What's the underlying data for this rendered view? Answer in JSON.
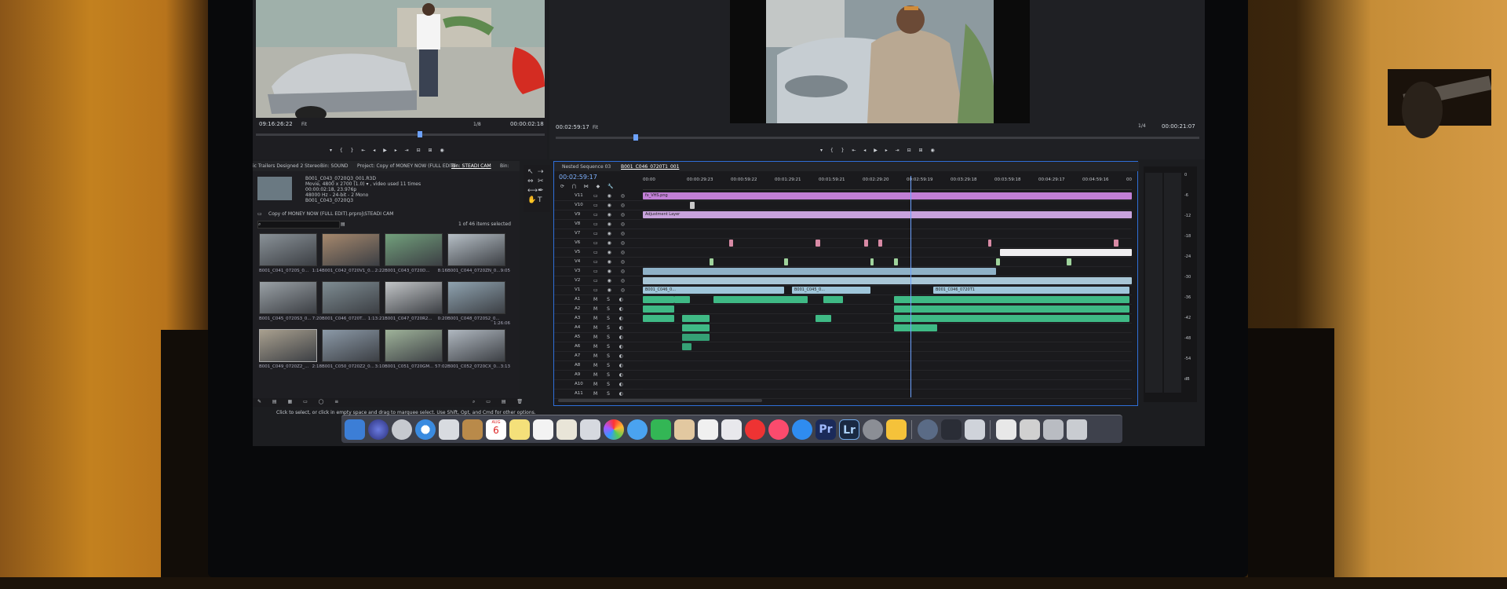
{
  "source_monitor": {
    "timecode_left": "09:16:26:22",
    "fit": "Fit",
    "fraction": "1/8",
    "timecode_right": "00:00:02:18"
  },
  "program_monitor": {
    "timecode_left": "00:02:59:17",
    "fit": "Fit",
    "fraction": "1/4",
    "timecode_right": "00:00:21:07"
  },
  "project_panel": {
    "tabs": [
      "ic Trailers Designed 2 Stereo",
      "Bin: SOUND",
      "Project: Copy of MONEY NOW (FULL EDIT)",
      "Bin: STEADI CAM",
      "Bin:"
    ],
    "clip_info": [
      "B001_C043_0720Q3_001.R3D",
      "Movie, 4800 x 2700 (1.0) ▾ , video used 11 times",
      "00:00:02:18, 23.976p",
      "48000 Hz - 24-bit - 2 Mono",
      "B001_C043_0720Q3"
    ],
    "path": "Copy of MONEY NOW (FULL EDIT).prproj\\STEADI CAM",
    "item_count": "1 of 46 items selected",
    "thumbnails": [
      {
        "name": "B001_C041_0720S_0...",
        "dur": "1:14"
      },
      {
        "name": "B001_C042_0720V1_0...",
        "dur": "2:22"
      },
      {
        "name": "B001_C043_0720D...",
        "dur": "8:16"
      },
      {
        "name": "B001_C044_0720ZN_0...",
        "dur": "9:05"
      },
      {
        "name": "B001_C045_0720S3_0...",
        "dur": "7:20"
      },
      {
        "name": "B001_C046_0720T...",
        "dur": "1:13:21"
      },
      {
        "name": "B001_C047_0720R2...",
        "dur": "0:20"
      },
      {
        "name": "B001_C048_0720S2_0...",
        "dur": "1:26:06"
      },
      {
        "name": "B001_C049_0720Z2_...",
        "dur": "2:18"
      },
      {
        "name": "B001_C050_0720Z2_0...",
        "dur": "3:10"
      },
      {
        "name": "B001_C051_0720GM...",
        "dur": "57:02"
      },
      {
        "name": "B001_C052_0720CX_0...",
        "dur": "3:13"
      }
    ]
  },
  "timeline": {
    "tabs": [
      "Nested Sequence 03",
      "B001_C046_0720T1_001"
    ],
    "timecode": "00:02:59:17",
    "ruler": [
      "00:00",
      "00:00:29:23",
      "00:00:59:22",
      "00:01:29:21",
      "00:01:59:21",
      "00:02:29:20",
      "00:02:59:19",
      "00:03:29:18",
      "00:03:59:18",
      "00:04:29:17",
      "00:04:59:16",
      "00"
    ],
    "video_tracks": [
      "V11",
      "V10",
      "V9",
      "V8",
      "V7",
      "V6",
      "V5",
      "V4",
      "V3",
      "V2",
      "V1"
    ],
    "audio_tracks": [
      "A1",
      "A2",
      "A3",
      "A4",
      "A5",
      "A6",
      "A7",
      "A8",
      "A9",
      "A10",
      "A11"
    ],
    "labels": {
      "fx": "fx_VHS.png",
      "adjustment": "Adjustment Layer",
      "clip_a": "B001_C046_0...",
      "clip_b": "B001_C045_0...",
      "clip_c": "B001_C046_0720T1"
    }
  },
  "meter_scale": [
    "0",
    "-6",
    "-12",
    "-18",
    "-24",
    "-30",
    "-36",
    "-42",
    "-48",
    "-54",
    "dB"
  ],
  "status_bar": "Click to select, or click in empty space and drag to marquee select. Use Shift, Opt, and Cmd for other options.",
  "dock": {
    "pr_label": "Pr",
    "lr_label": "Lr",
    "calendar_day": "6",
    "calendar_month": "AUG"
  },
  "colors": {
    "accent_blue": "#2f6fd8",
    "clip_violet": "#c17fd6",
    "clip_cyan": "#9fc6da",
    "audio_green": "#3fb985"
  }
}
